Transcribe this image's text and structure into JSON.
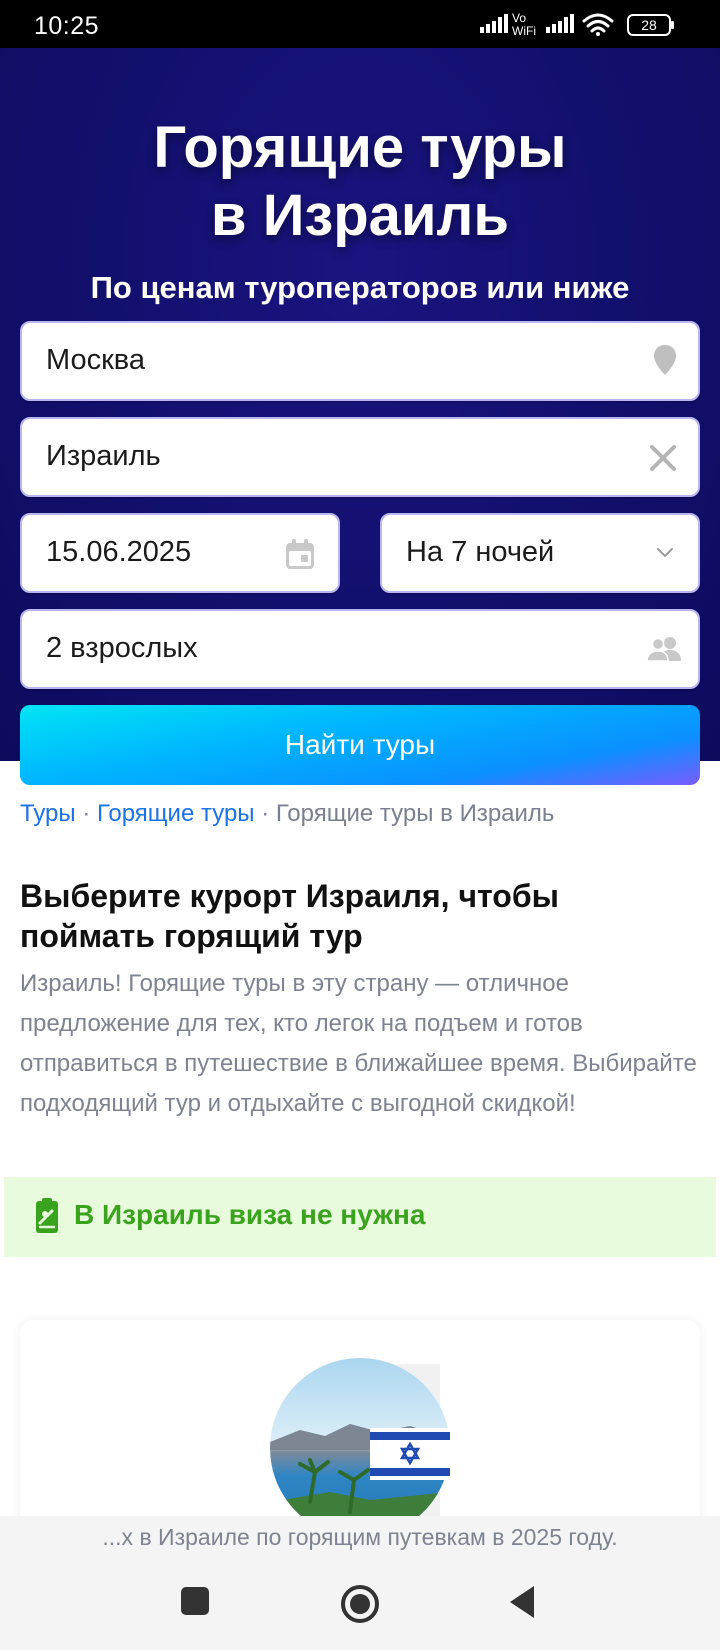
{
  "status_bar": {
    "time": "10:25",
    "signal_label": "Vo WiFi",
    "battery": "28"
  },
  "hero": {
    "title_line1": "Горящие туры",
    "title_line2": "в Израиль",
    "subtitle": "По ценам туроператоров или ниже"
  },
  "search": {
    "from_value": "Москва",
    "to_value": "Израиль",
    "date_value": "15.06.2025",
    "nights_value": "На 7 ночей",
    "people_value": "2 взрослых",
    "submit_label": "Найти туры"
  },
  "breadcrumb": {
    "items": [
      "Туры",
      "Горящие туры",
      "Горящие туры в Израиль"
    ],
    "separator": "·"
  },
  "content": {
    "heading": "Выберите курорт Израиля, чтобы поймать горящий тур",
    "description": "Израиль! Горящие туры в эту страну — отличное предложение для тех, кто легок на подъем и готов отправиться в путешествие в ближайшее время. Выбирайте подходящий тур и отдыхайте с выгодной скидкой!",
    "visa_notice": "В Израиль виза не нужна"
  },
  "footer_banner": {
    "text": "...х в Израиле по горящим путевкам в 2025 году."
  },
  "colors": {
    "hero_bg": "#12106e",
    "link": "#1a73e8",
    "visa_green": "#3aa31e",
    "visa_bg": "#e8fbdc"
  }
}
